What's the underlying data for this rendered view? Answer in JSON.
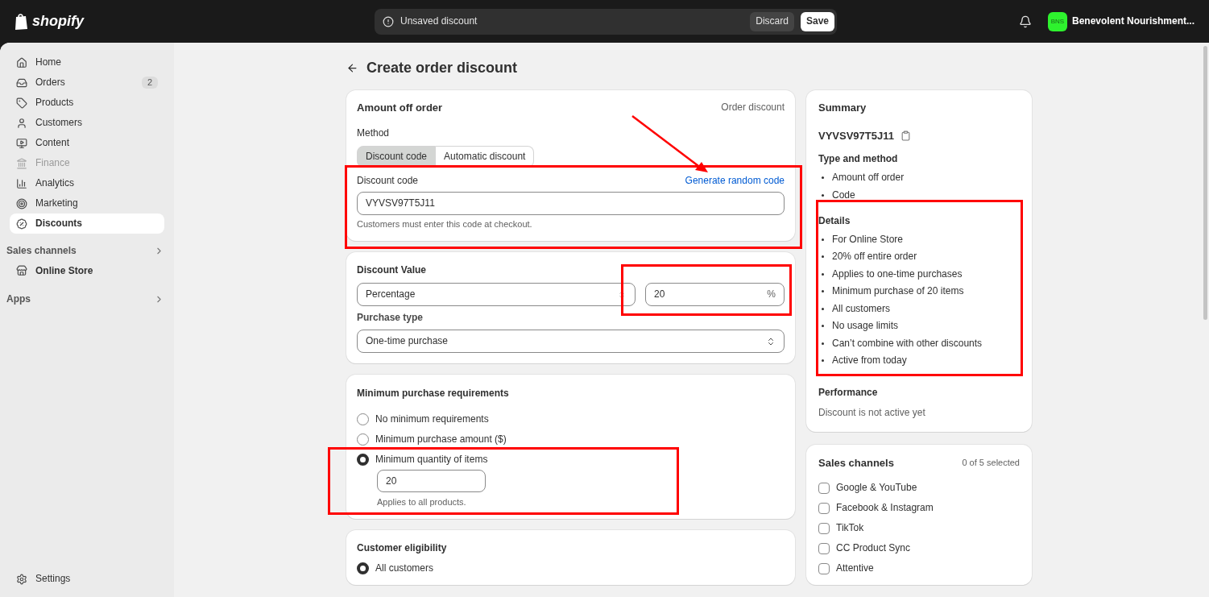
{
  "top_bar": {
    "logo": "shopify",
    "unsaved": {
      "message": "Unsaved discount",
      "discard": "Discard",
      "save": "Save"
    },
    "store": {
      "initials": "BNS",
      "name": "Benevolent Nourishment..."
    }
  },
  "sidebar": {
    "items": [
      {
        "label": "Home",
        "selected": false,
        "disabled": false
      },
      {
        "label": "Orders",
        "badge": "2",
        "selected": false,
        "disabled": false
      },
      {
        "label": "Products",
        "selected": false,
        "disabled": false
      },
      {
        "label": "Customers",
        "selected": false,
        "disabled": false
      },
      {
        "label": "Content",
        "selected": false,
        "disabled": false
      },
      {
        "label": "Finance",
        "selected": false,
        "disabled": true
      },
      {
        "label": "Analytics",
        "selected": false,
        "disabled": false
      },
      {
        "label": "Marketing",
        "selected": false,
        "disabled": false
      },
      {
        "label": "Discounts",
        "selected": true,
        "disabled": false
      }
    ],
    "sections": [
      {
        "title": "Sales channels",
        "children": [
          {
            "label": "Online Store"
          }
        ]
      },
      {
        "title": "Apps"
      }
    ],
    "settings": "Settings"
  },
  "page": {
    "title": "Create order discount",
    "method_card": {
      "title": "Amount off order",
      "kind_label": "Order discount",
      "method_label": "Method",
      "methods": [
        {
          "label": "Discount code",
          "selected": true
        },
        {
          "label": "Automatic discount",
          "selected": false
        }
      ],
      "code_label": "Discount code",
      "generate_link": "Generate random code",
      "code_value": "VYVSV97T5J11",
      "help": "Customers must enter this code at checkout."
    },
    "value_card": {
      "title": "Discount Value",
      "type_value": "Percentage",
      "amount": "20",
      "suffix": "%",
      "purchase_label": "Purchase type",
      "purchase_value": "One-time purchase"
    },
    "minimum_card": {
      "title": "Minimum purchase requirements",
      "options": [
        {
          "label": "No minimum requirements",
          "selected": false
        },
        {
          "label": "Minimum purchase amount ($)",
          "selected": false
        },
        {
          "label": "Minimum quantity of items",
          "selected": true,
          "value": "20",
          "help": "Applies to all products."
        }
      ]
    },
    "eligibility_card": {
      "title": "Customer eligibility",
      "options": [
        {
          "label": "All customers",
          "selected": true
        }
      ]
    },
    "summary": {
      "title": "Summary",
      "code": "VYVSV97T5J11",
      "sections": [
        {
          "title": "Type and method",
          "items": [
            "Amount off order",
            "Code"
          ]
        },
        {
          "title": "Details",
          "items": [
            "For Online Store",
            "20% off entire order",
            "Applies to one-time purchases",
            "Minimum purchase of 20 items",
            "All customers",
            "No usage limits",
            "Can’t combine with other discounts",
            "Active from today"
          ]
        }
      ],
      "performance_title": "Performance",
      "performance_text": "Discount is not active yet"
    },
    "sales_channels": {
      "title": "Sales channels",
      "count": "0 of 5 selected",
      "channels": [
        {
          "label": "Google & YouTube",
          "checked": false
        },
        {
          "label": "Facebook & Instagram",
          "checked": false
        },
        {
          "label": "TikTok",
          "checked": false
        },
        {
          "label": "CC Product Sync",
          "checked": false
        },
        {
          "label": "Attentive",
          "checked": false
        }
      ]
    }
  }
}
